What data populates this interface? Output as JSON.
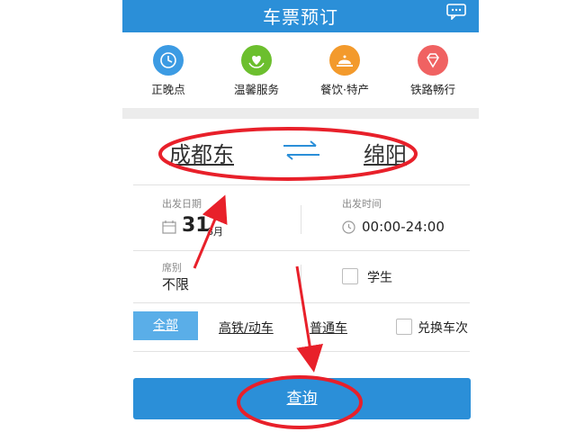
{
  "header": {
    "title": "车票预订",
    "message_icon": "chat-bubble-icon"
  },
  "services": [
    {
      "label": "正晚点",
      "icon": "clock-icon",
      "color": "#3c9be3"
    },
    {
      "label": "温馨服务",
      "icon": "heart-hands-icon",
      "color": "#6cbf2e"
    },
    {
      "label": "餐饮·特产",
      "icon": "dining-cloche-icon",
      "color": "#f39a2c"
    },
    {
      "label": "铁路畅行",
      "icon": "diamond-icon",
      "color": "#f06262"
    }
  ],
  "route": {
    "from": "成都东",
    "to": "绵阳",
    "swap_icon": "swap-arrows-icon"
  },
  "date": {
    "label": "出发日期",
    "day": "31",
    "month_suffix": "8月"
  },
  "time": {
    "label": "出发时间",
    "value": "00:00-24:00"
  },
  "seat": {
    "label": "席别",
    "value": "不限"
  },
  "student": {
    "label": "学生",
    "checked": false
  },
  "train_types": {
    "all": "全部",
    "high_speed": "高铁/动车",
    "normal": "普通车"
  },
  "exchange": {
    "label": "兑换车次",
    "checked": false
  },
  "query_button": "查询",
  "colors": {
    "primary": "#2b8fd8",
    "annotation": "#e8202a"
  }
}
